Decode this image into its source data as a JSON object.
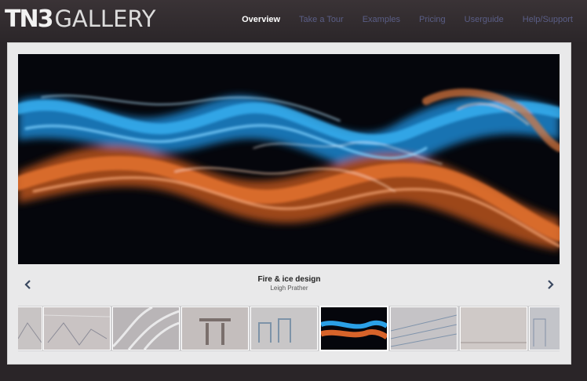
{
  "header": {
    "logo_tn3": "TN3",
    "logo_gallery": "GALLERY",
    "nav": [
      {
        "label": "Overview",
        "active": true
      },
      {
        "label": "Take a Tour",
        "active": false
      },
      {
        "label": "Examples",
        "active": false
      },
      {
        "label": "Pricing",
        "active": false
      },
      {
        "label": "Userguide",
        "active": false
      },
      {
        "label": "Help/Support",
        "active": false
      }
    ]
  },
  "gallery": {
    "current": {
      "title": "Fire & ice design",
      "author": "Leigh Prather"
    },
    "thumbnails": [
      {
        "name": "thumb-1",
        "selected": false
      },
      {
        "name": "thumb-2",
        "selected": false
      },
      {
        "name": "thumb-3",
        "selected": false
      },
      {
        "name": "thumb-4",
        "selected": false
      },
      {
        "name": "thumb-5",
        "selected": false
      },
      {
        "name": "thumb-6",
        "selected": true
      },
      {
        "name": "thumb-7",
        "selected": false
      },
      {
        "name": "thumb-8",
        "selected": false
      },
      {
        "name": "thumb-9",
        "selected": false
      }
    ],
    "icons": {
      "prev": "chevron-left-icon",
      "next": "chevron-right-icon"
    },
    "colors": {
      "fire": "#d7632a",
      "ice": "#2ba0e6",
      "nav_active": "#ffffff",
      "nav_inactive": "#5a5e86"
    }
  }
}
